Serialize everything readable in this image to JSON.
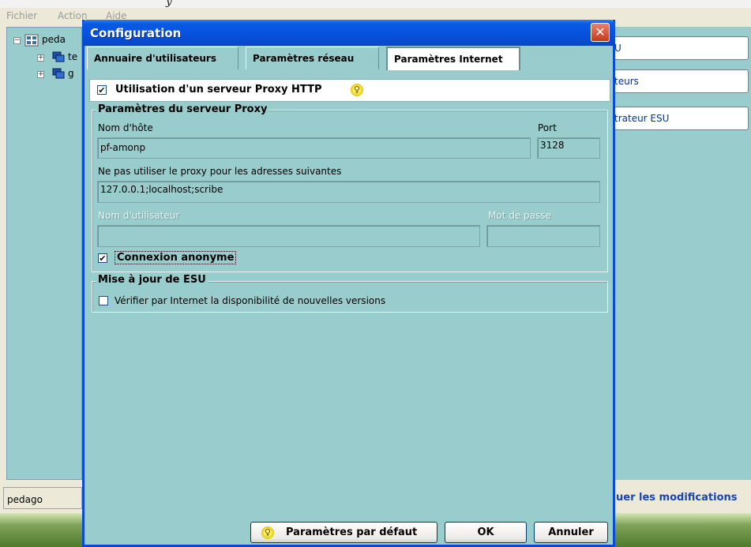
{
  "background_app": {
    "title_fragment": "y",
    "menu": [
      "Fichier",
      "Action",
      "Aide"
    ],
    "tree": {
      "root_label": "peda",
      "child1_label": "te",
      "child2_label": "g"
    },
    "side_buttons": [
      "U",
      "teurs",
      "trateur ESU"
    ],
    "status_left": "pedago",
    "apply_link": "uer les modifications"
  },
  "dialog": {
    "title": "Configuration",
    "close_glyph": "✕",
    "tabs": [
      {
        "label": "Annuaire d'utilisateurs",
        "active": false
      },
      {
        "label": "Paramètres réseau",
        "active": false
      },
      {
        "label": "Paramètres Internet",
        "active": true
      }
    ],
    "proxy_toggle": {
      "label": "Utilisation d'un serveur Proxy HTTP",
      "checked": "✔",
      "hint_icon": "lightbulb-icon"
    },
    "proxy_group": {
      "title": "Paramètres du serveur Proxy",
      "host_label": "Nom d'hôte",
      "host_value": "pf-amonp",
      "port_label": "Port",
      "port_value": "3128",
      "exclusions_label": "Ne pas utiliser le proxy pour les adresses suivantes",
      "exclusions_value": "127.0.0.1;localhost;scribe",
      "user_label": "Nom d'utilisateur",
      "password_label": "Mot de passe",
      "anonymous_label": "Connexion anonyme",
      "anonymous_checked": "✔"
    },
    "update_group": {
      "title": "Mise à jour de ESU",
      "check_label": "Vérifier par Internet la disponibilité de nouvelles versions"
    },
    "buttons": {
      "defaults": "Paramètres par défaut",
      "ok": "OK",
      "cancel": "Annuler"
    }
  },
  "colors": {
    "panel_bg": "#99cccc",
    "titlebar_blue": "#0551dc",
    "link_blue": "#1a45b0"
  }
}
